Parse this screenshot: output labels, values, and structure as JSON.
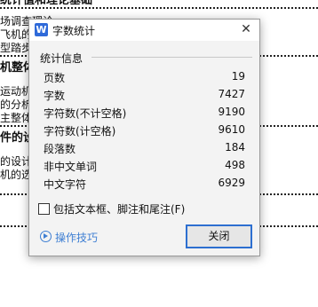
{
  "document": {
    "lines": [
      {
        "text": "统计值和理论基础",
        "bold": true
      },
      {
        "text": "场调查理论",
        "bold": false
      },
      {
        "text": "飞机的线",
        "bold": false
      },
      {
        "text": "型踏步机",
        "bold": false
      },
      {
        "text": "机整体",
        "bold": true
      },
      {
        "text": "运动机",
        "bold": false
      },
      {
        "text": "的分析",
        "bold": false
      },
      {
        "text": "主整体",
        "bold": false
      },
      {
        "text": "件的设计",
        "bold": true
      },
      {
        "text": "的设计",
        "bold": false
      },
      {
        "text": "机的选用",
        "bold": false
      }
    ]
  },
  "dialog": {
    "title": "字数统计",
    "app_icon_letter": "W",
    "close_glyph": "✕",
    "group_title": "统计信息",
    "stats": [
      {
        "label": "页数",
        "value": "19"
      },
      {
        "label": "字数",
        "value": "7427"
      },
      {
        "label": "字符数(不计空格)",
        "value": "9190"
      },
      {
        "label": "字符数(计空格)",
        "value": "9610"
      },
      {
        "label": "段落数",
        "value": "184"
      },
      {
        "label": "非中文单词",
        "value": "498"
      },
      {
        "label": "中文字符",
        "value": "6929"
      }
    ],
    "checkbox_label": "包括文本框、脚注和尾注(F)",
    "checkbox_checked": false,
    "tips_link": "操作技巧",
    "close_button": "关闭",
    "accent_color": "#2d6fd0"
  }
}
